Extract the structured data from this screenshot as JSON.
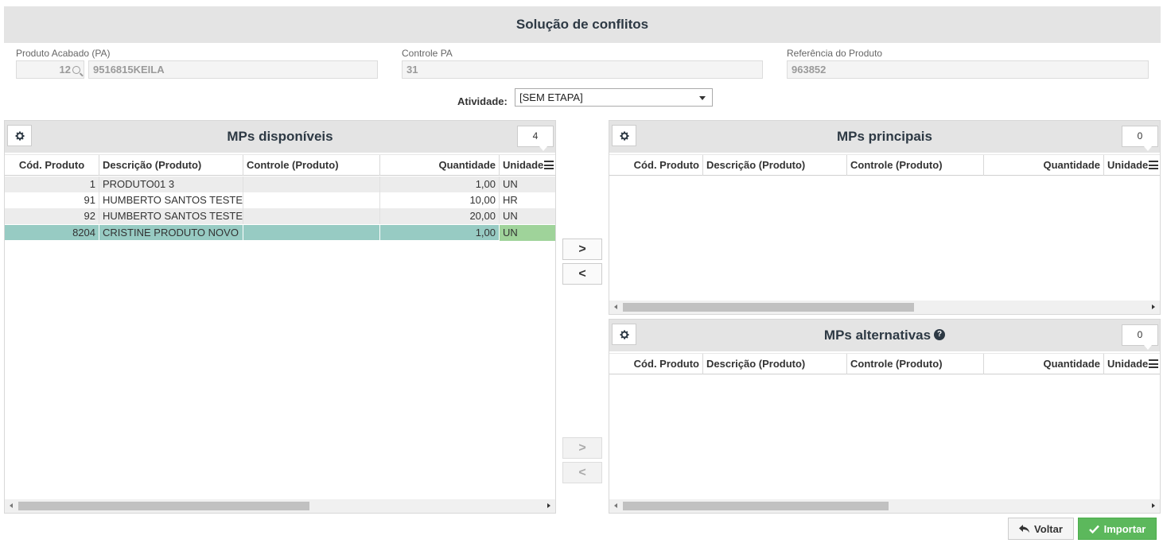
{
  "page": {
    "title": "Solução de conflitos"
  },
  "fields": {
    "produto_acabado": {
      "label": "Produto Acabado (PA)",
      "code": "12",
      "value": "9516815KEILA"
    },
    "controle_pa": {
      "label": "Controle PA",
      "value": "31"
    },
    "referencia": {
      "label": "Referência do Produto",
      "value": "963852"
    }
  },
  "atividade": {
    "label": "Atividade:",
    "selected": "[SEM ETAPA]"
  },
  "columns": [
    "Cód. Produto",
    "Descrição (Produto)",
    "Controle (Produto)",
    "Quantidade",
    "Unidade"
  ],
  "panels": {
    "disponiveis": {
      "title": "MPs disponíveis",
      "count": "4",
      "rows": [
        {
          "codigo": "1",
          "descricao": "PRODUTO01 3",
          "controle": "",
          "quantidade": "1,00",
          "unidade": "UN"
        },
        {
          "codigo": "91",
          "descricao": "HUMBERTO SANTOS TESTE",
          "controle": "",
          "quantidade": "10,00",
          "unidade": "HR"
        },
        {
          "codigo": "92",
          "descricao": "HUMBERTO SANTOS TESTE",
          "controle": "",
          "quantidade": "20,00",
          "unidade": "UN"
        },
        {
          "codigo": "8204",
          "descricao": "CRISTINE PRODUTO NOVO",
          "controle": "",
          "quantidade": "1,00",
          "unidade": "UN"
        }
      ]
    },
    "principais": {
      "title": "MPs principais",
      "count": "0"
    },
    "alternativas": {
      "title": "MPs alternativas",
      "count": "0"
    }
  },
  "buttons": {
    "voltar": "Voltar",
    "importar": "Importar",
    "move_right": ">",
    "move_left": "<"
  },
  "colors": {
    "header_bg": "#e4e4e4",
    "selected_row": "#97cbc3",
    "importar": "#5cb85c"
  }
}
